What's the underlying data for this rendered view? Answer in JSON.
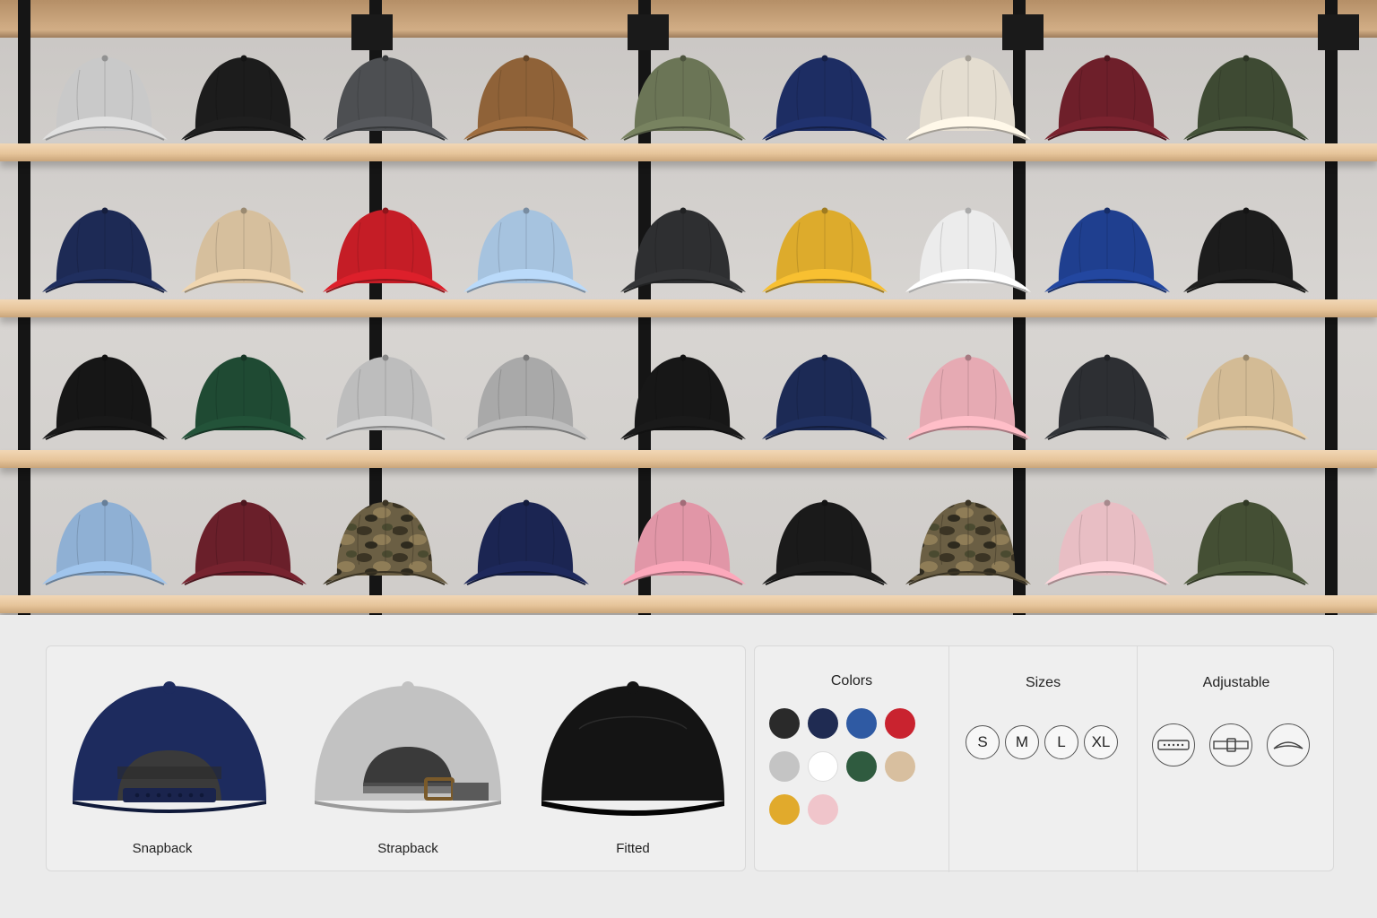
{
  "shelf_rows": [
    [
      "#c9c9c9",
      "#1c1c1c",
      "#4d4f52",
      "#8f6238",
      "#6b7556",
      "#1d2d63",
      "#e4ddd0",
      "#6e1f2a",
      "#3e4a33"
    ],
    [
      "#1d2a55",
      "#d6bf9d",
      "#c51d26",
      "#a6c3df",
      "#2e2f31",
      "#ddab2c",
      "#ececec",
      "#1f3f8f",
      "#1c1c1c"
    ],
    [
      "#161616",
      "#1f4a33",
      "#bdbdbd",
      "#a9a9a9",
      "#171717",
      "#1c2a55",
      "#e6aab3",
      "#2d2f33",
      "#d3bb95"
    ],
    [
      "#8fb0d4",
      "#6a1f2a",
      "camo",
      "#1b2552",
      "#e196a7",
      "#1a1a1a",
      "camo",
      "#e8bec4",
      "#444f34"
    ]
  ],
  "styles": {
    "title": "",
    "items": [
      {
        "label": "Snapback",
        "color": "#1d2b5e",
        "icon": "snapback-cap-back"
      },
      {
        "label": "Strapback",
        "color": "#c2c2c2",
        "icon": "strapback-cap-back"
      },
      {
        "label": "Fitted",
        "color": "#141414",
        "icon": "fitted-cap-back"
      }
    ]
  },
  "colors": {
    "title": "Colors",
    "swatches": [
      "#2a2a2a",
      "#1f2b52",
      "#2f5aa3",
      "#c9232f",
      "#c4c4c4",
      "#ffffff",
      "#2f5b3f",
      "#d8bf9f",
      "#e1aa2c",
      "#f0c5cb"
    ]
  },
  "sizes": {
    "title": "Sizes",
    "options": [
      "S",
      "M",
      "L",
      "XL"
    ]
  },
  "adjustable": {
    "title": "Adjustable",
    "options": [
      {
        "icon": "snap-strap-icon"
      },
      {
        "icon": "buckle-strap-icon"
      },
      {
        "icon": "visor-curve-icon"
      }
    ]
  }
}
